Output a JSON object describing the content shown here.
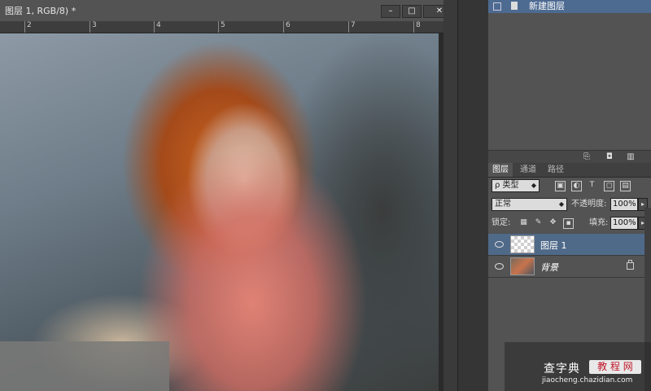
{
  "document": {
    "tab_title": "图层 1, RGB/8) *",
    "window_buttons": {
      "minimize": "–",
      "maximize": "□",
      "close": "✕"
    },
    "ruler_ticks": [
      "2",
      "3",
      "4",
      "5",
      "6",
      "7",
      "8"
    ]
  },
  "history_panel": {
    "row_label": "新建图层"
  },
  "layers_panel": {
    "tabs": [
      "图层",
      "通道",
      "路径"
    ],
    "filter_select": "ρ 类型",
    "filter_icons": [
      "image-filter-icon",
      "adjustment-filter-icon",
      "type-filter-icon",
      "shape-filter-icon",
      "smart-object-filter-icon"
    ],
    "blend_mode": "正常",
    "opacity_label": "不透明度:",
    "opacity_value": "100%",
    "lock_label": "锁定:",
    "fill_label": "填充:",
    "fill_value": "100%",
    "layers": [
      {
        "name": "图层 1",
        "selected": true,
        "thumb": "transparent"
      },
      {
        "name": "背景",
        "selected": false,
        "thumb": "photo",
        "locked": true
      }
    ]
  },
  "watermark": {
    "site_name": "查字典",
    "sub_label": "教 程 网",
    "url": "jiaocheng.chazidian.com"
  },
  "colors": {
    "selection_blue": "#4f6989",
    "panel_gray": "#535353"
  }
}
